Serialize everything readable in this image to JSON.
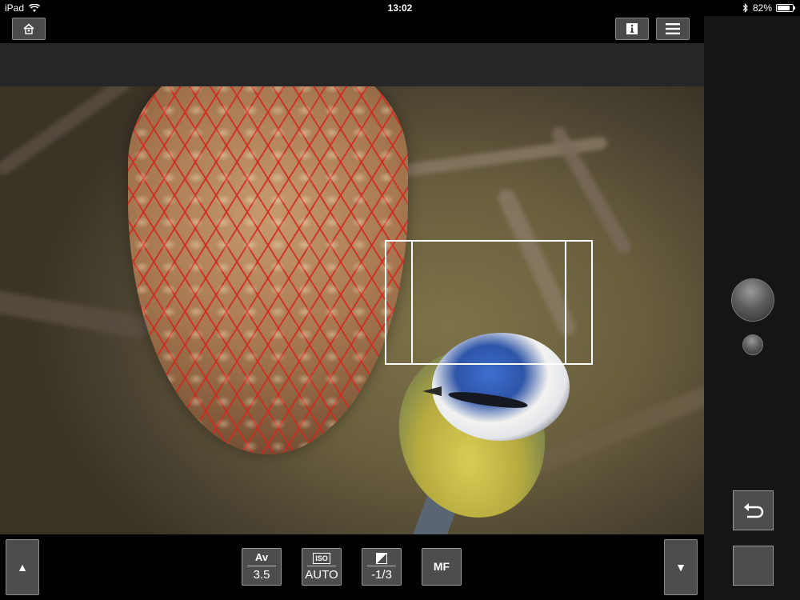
{
  "status_bar": {
    "device": "iPad",
    "time": "13:02",
    "battery": "82%",
    "battery_level": 0.82
  },
  "top_bar": {
    "home_icon": "home-icon",
    "info_icon": "info-icon",
    "menu_icon": "hamburger-menu-icon"
  },
  "bottom_bar": {
    "av": {
      "label": "Av",
      "value": "3.5"
    },
    "iso": {
      "label": "ISO",
      "value": "AUTO"
    },
    "exposure": {
      "icon": "exposure-compensation-icon",
      "value": "-1/3"
    },
    "focus_mode": {
      "label": "MF"
    },
    "up_arrow": "▲",
    "down_arrow": "▼"
  },
  "right_panel": {
    "shutter_icon": "shutter-button",
    "return_icon": "return-arrow-icon"
  }
}
